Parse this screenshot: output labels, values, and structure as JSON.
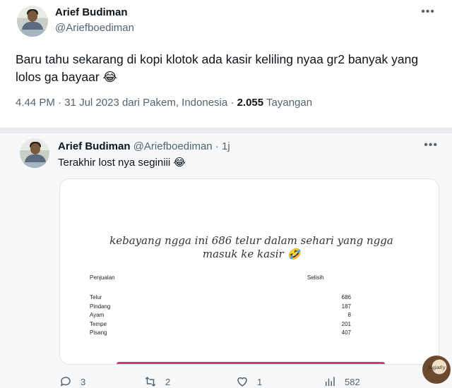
{
  "main_tweet": {
    "author_name": "Arief Budiman",
    "author_handle": "@Ariefboediman",
    "text": "Baru tahu sekarang di kopi klotok ada kasir keliling nyaa gr2 banyak yang lolos ga bayaar 😂",
    "time": "4.44 PM",
    "date": "31 Jul 2023",
    "location_prefix": "dari",
    "location": "Pakem, Indonesia",
    "views_count": "2.055",
    "views_label": "Tayangan"
  },
  "reply": {
    "author_name": "Arief Budiman",
    "author_handle": "@Ariefboediman",
    "separator": "·",
    "time": "1j",
    "text": "Terakhir lost nya seginiii 😂",
    "media": {
      "caption": "kebayang ngga ini 686 telur dalam sehari yang ngga masuk ke kasir 🤣",
      "col_left": "Penjualan",
      "col_right": "Selisih",
      "rows": [
        {
          "item": "Telur",
          "value": "686"
        },
        {
          "item": "Pindang",
          "value": "187"
        },
        {
          "item": "Ayam",
          "value": "8"
        },
        {
          "item": "Tempe",
          "value": "201"
        },
        {
          "item": "Pisang",
          "value": "407"
        }
      ]
    },
    "actions": {
      "reply_count": "3",
      "retweet_count": "2",
      "like_count": "1",
      "views_count": "582"
    }
  },
  "watermark": {
    "text": "Jogjadiy"
  },
  "icons": {
    "more": "more-horizontal-icon",
    "reply": "comment-icon",
    "retweet": "retweet-icon",
    "like": "heart-icon",
    "views": "views-bar-chart-icon"
  },
  "colors": {
    "text_primary": "#0f1419",
    "text_secondary": "#536471",
    "accent_bar": "#d8347a"
  }
}
